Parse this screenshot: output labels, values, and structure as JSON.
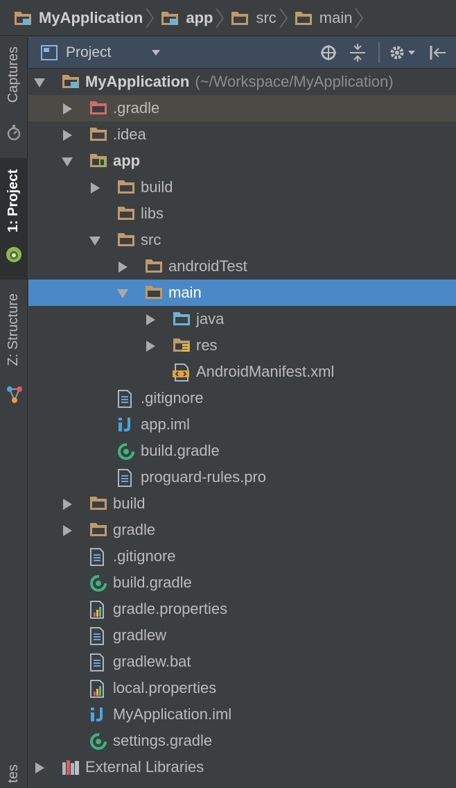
{
  "breadcrumb": [
    {
      "label": "MyApplication",
      "icon": "module-folder-icon",
      "bold": true
    },
    {
      "label": "app",
      "icon": "module-folder-icon",
      "bold": true
    },
    {
      "label": "src",
      "icon": "folder-icon",
      "bold": false
    },
    {
      "label": "main",
      "icon": "folder-icon",
      "bold": false
    }
  ],
  "tool_strip": {
    "captures": "Captures",
    "project": "1: Project",
    "structure": "Z: Structure",
    "bottom": "tes"
  },
  "panel_header": {
    "view_label": "Project"
  },
  "tree": [
    {
      "label": "MyApplication",
      "hint": "(~/Workspace/MyApplication)",
      "depth": 0,
      "arrow": "down",
      "icon": "module",
      "bold": true
    },
    {
      "label": ".gradle",
      "depth": 1,
      "arrow": "right",
      "icon": "folder-red",
      "state": "hover"
    },
    {
      "label": ".idea",
      "depth": 1,
      "arrow": "right",
      "icon": "folder"
    },
    {
      "label": "app",
      "depth": 1,
      "arrow": "down",
      "icon": "android-module",
      "bold": true
    },
    {
      "label": "build",
      "depth": 2,
      "arrow": "right",
      "icon": "folder"
    },
    {
      "label": "libs",
      "depth": 2,
      "arrow": "none",
      "icon": "folder"
    },
    {
      "label": "src",
      "depth": 2,
      "arrow": "down",
      "icon": "folder"
    },
    {
      "label": "androidTest",
      "depth": 3,
      "arrow": "right",
      "icon": "folder"
    },
    {
      "label": "main",
      "depth": 3,
      "arrow": "down",
      "icon": "folder",
      "state": "selected"
    },
    {
      "label": "java",
      "depth": 4,
      "arrow": "right",
      "icon": "folder-blue"
    },
    {
      "label": "res",
      "depth": 4,
      "arrow": "right",
      "icon": "folder-res"
    },
    {
      "label": "AndroidManifest.xml",
      "depth": 4,
      "arrow": "none",
      "icon": "xml"
    },
    {
      "label": ".gitignore",
      "depth": 2,
      "arrow": "none",
      "icon": "text"
    },
    {
      "label": "app.iml",
      "depth": 2,
      "arrow": "none",
      "icon": "iml"
    },
    {
      "label": "build.gradle",
      "depth": 2,
      "arrow": "none",
      "icon": "gradle"
    },
    {
      "label": "proguard-rules.pro",
      "depth": 2,
      "arrow": "none",
      "icon": "text"
    },
    {
      "label": "build",
      "depth": 1,
      "arrow": "right",
      "icon": "folder"
    },
    {
      "label": "gradle",
      "depth": 1,
      "arrow": "right",
      "icon": "folder"
    },
    {
      "label": ".gitignore",
      "depth": 1,
      "arrow": "none",
      "icon": "text"
    },
    {
      "label": "build.gradle",
      "depth": 1,
      "arrow": "none",
      "icon": "gradle"
    },
    {
      "label": "gradle.properties",
      "depth": 1,
      "arrow": "none",
      "icon": "properties"
    },
    {
      "label": "gradlew",
      "depth": 1,
      "arrow": "none",
      "icon": "text"
    },
    {
      "label": "gradlew.bat",
      "depth": 1,
      "arrow": "none",
      "icon": "text"
    },
    {
      "label": "local.properties",
      "depth": 1,
      "arrow": "none",
      "icon": "properties"
    },
    {
      "label": "MyApplication.iml",
      "depth": 1,
      "arrow": "none",
      "icon": "iml"
    },
    {
      "label": "settings.gradle",
      "depth": 1,
      "arrow": "none",
      "icon": "gradle"
    },
    {
      "label": "External Libraries",
      "depth": 0,
      "arrow": "right",
      "icon": "libraries"
    }
  ],
  "colors": {
    "background": "#3c3f41",
    "selection": "#4a88c7",
    "hover": "#4b4a44",
    "folder": "#c09a6b",
    "folder_red": "#d46a6a",
    "folder_blue": "#6fb2d8",
    "gradle": "#3fb37f"
  }
}
